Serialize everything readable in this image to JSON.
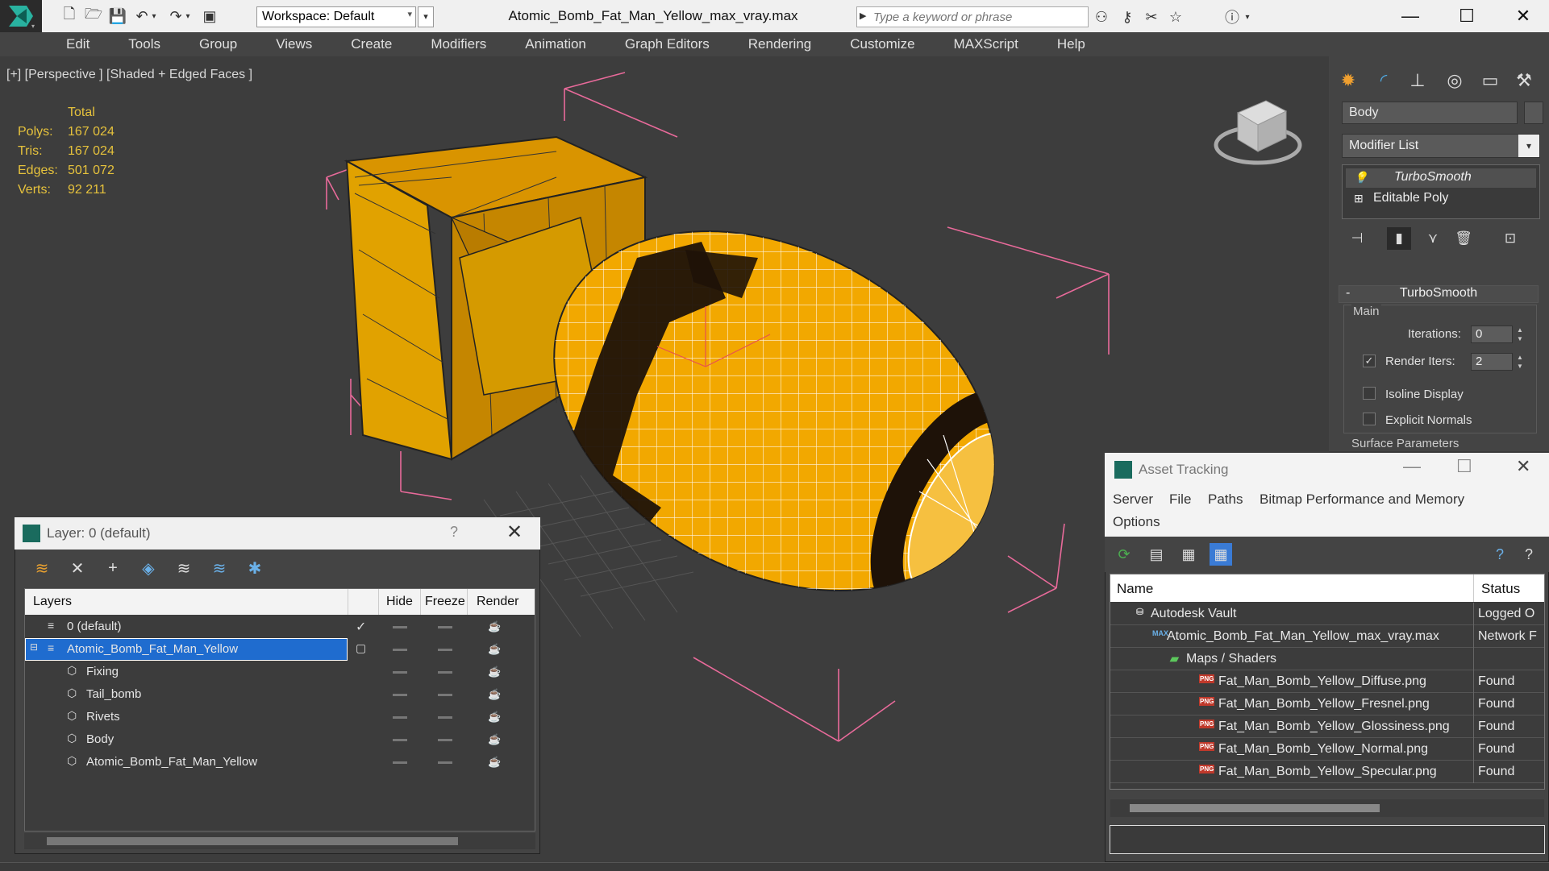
{
  "app": {
    "window_title": "Atomic_Bomb_Fat_Man_Yellow_max_vray.max",
    "workspace_label": "Workspace: Default",
    "search_placeholder": "Type a keyword or phrase"
  },
  "menu": [
    "Edit",
    "Tools",
    "Group",
    "Views",
    "Create",
    "Modifiers",
    "Animation",
    "Graph Editors",
    "Rendering",
    "Customize",
    "MAXScript",
    "Help"
  ],
  "viewport": {
    "label": "[+] [Perspective ] [Shaded + Edged Faces ]",
    "stats_header": "Total",
    "stats": [
      {
        "key": "Polys:",
        "value": "167 024"
      },
      {
        "key": "Tris:",
        "value": "167 024"
      },
      {
        "key": "Edges:",
        "value": "501 072"
      },
      {
        "key": "Verts:",
        "value": "92 211"
      }
    ]
  },
  "command_panel": {
    "object_name": "Body",
    "modifier_list": "Modifier List",
    "stack": [
      "TurboSmooth",
      "Editable Poly"
    ],
    "rollout_title": "TurboSmooth",
    "main_group": "Main",
    "iterations_label": "Iterations:",
    "iterations_value": "0",
    "render_iters_label": "Render Iters:",
    "render_iters_value": "2",
    "render_iters_checked": true,
    "isoline_label": "Isoline Display",
    "explicit_normals_label": "Explicit Normals",
    "surface_params_label": "Surface Parameters"
  },
  "layer_dialog": {
    "title": "Layer: 0 (default)",
    "help": "?",
    "columns": {
      "layers": "Layers",
      "hide": "Hide",
      "freeze": "Freeze",
      "render": "Render"
    },
    "rows": [
      {
        "name": "0 (default)",
        "type": "layer",
        "active": true
      },
      {
        "name": "Atomic_Bomb_Fat_Man_Yellow",
        "type": "layer",
        "selected": true
      },
      {
        "name": "Fixing",
        "type": "object"
      },
      {
        "name": "Tail_bomb",
        "type": "object"
      },
      {
        "name": "Rivets",
        "type": "object"
      },
      {
        "name": "Body",
        "type": "object"
      },
      {
        "name": "Atomic_Bomb_Fat_Man_Yellow",
        "type": "object"
      }
    ]
  },
  "asset_dialog": {
    "title": "Asset Tracking",
    "menu": [
      "Server",
      "File",
      "Paths",
      "Bitmap Performance and Memory",
      "Options"
    ],
    "columns": {
      "name": "Name",
      "status": "Status"
    },
    "rows": [
      {
        "name": "Autodesk Vault",
        "status": "Logged O",
        "level": 1,
        "icon": "vault-icon"
      },
      {
        "name": "Atomic_Bomb_Fat_Man_Yellow_max_vray.max",
        "status": "Network F",
        "level": 2,
        "icon": "max-file-icon"
      },
      {
        "name": "Maps / Shaders",
        "status": "",
        "level": 3,
        "icon": "maps-folder-icon"
      },
      {
        "name": "Fat_Man_Bomb_Yellow_Diffuse.png",
        "status": "Found",
        "level": 4,
        "icon": "png-icon"
      },
      {
        "name": "Fat_Man_Bomb_Yellow_Fresnel.png",
        "status": "Found",
        "level": 4,
        "icon": "png-icon"
      },
      {
        "name": "Fat_Man_Bomb_Yellow_Glossiness.png",
        "status": "Found",
        "level": 4,
        "icon": "png-icon"
      },
      {
        "name": "Fat_Man_Bomb_Yellow_Normal.png",
        "status": "Found",
        "level": 4,
        "icon": "png-icon"
      },
      {
        "name": "Fat_Man_Bomb_Yellow_Specular.png",
        "status": "Found",
        "level": 4,
        "icon": "png-icon"
      }
    ]
  },
  "colors": {
    "bomb_yellow": "#f2a800",
    "stats_yellow": "#e6c23c",
    "selection_blue": "#1f6ccf",
    "bounding_box_pink": "#e86a9a"
  }
}
